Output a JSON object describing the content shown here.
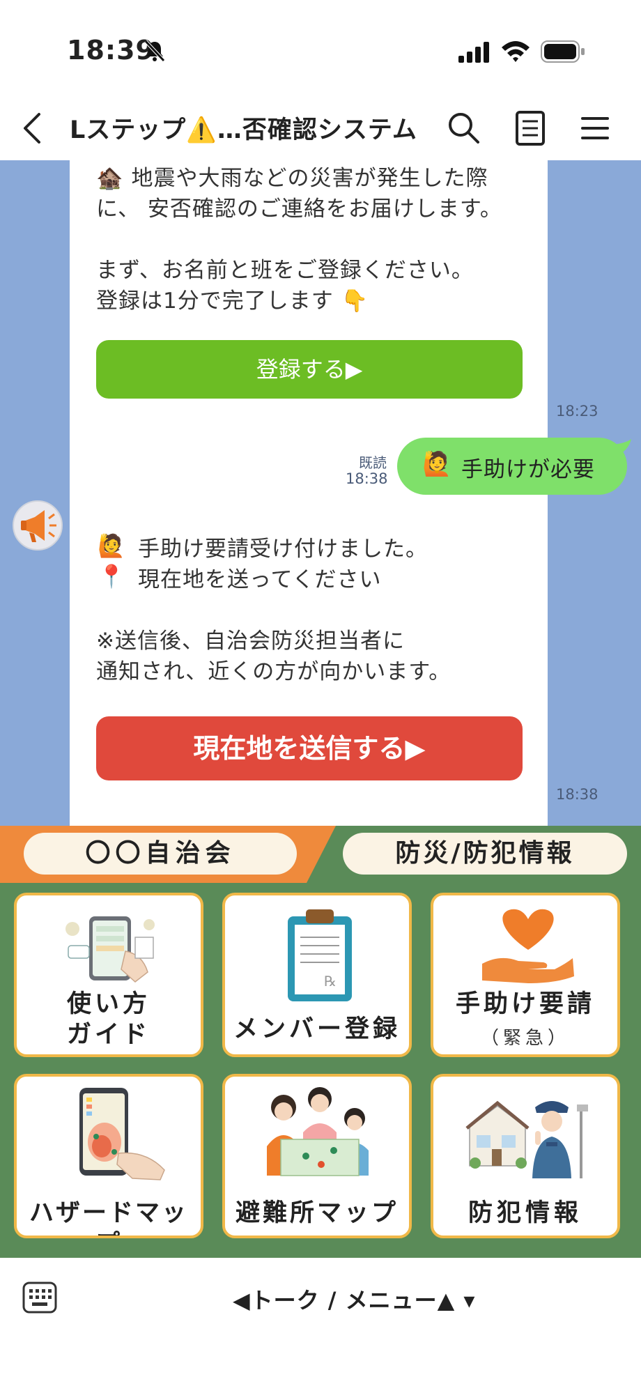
{
  "status_bar": {
    "time": "18:39"
  },
  "header": {
    "title": "Lステップ⚠️…否確認システム"
  },
  "messages": {
    "first": {
      "line1": "🏚️ 地震や大雨などの災害が発生した際",
      "line2": "に、 安否確認のご連絡をお届けします。",
      "line3": "まず、お名前と班をご登録ください。",
      "line4": "登録は1分で完了します 👇",
      "button": "登録する▶",
      "time": "18:23"
    },
    "sent": {
      "text": "手助けが必要",
      "emoji": "🙋",
      "read_label": "既読",
      "time": "18:38"
    },
    "second": {
      "line1": "手助け要請受け付けました。",
      "line2": "現在地を送ってください",
      "emoji1": "🙋",
      "emoji2": "📍",
      "line3": "※送信後、自治会防災担当者に",
      "line4": "通知され、近くの方が向かいます。",
      "button": "現在地を送信する▶",
      "time": "18:38"
    }
  },
  "rich_menu": {
    "tabs": [
      "〇〇自治会",
      "防災/防犯情報"
    ],
    "tiles": [
      {
        "label_line1": "使い方",
        "label_line2": "ガイド",
        "icon": "guide-icon"
      },
      {
        "label": "メンバー登録",
        "icon": "clipboard-icon"
      },
      {
        "label": "手助け要請",
        "sub": "（緊急）",
        "icon": "heart-hand-icon"
      },
      {
        "label": "ハザードマップ",
        "icon": "hazard-map-icon"
      },
      {
        "label": "避難所マップ",
        "icon": "shelter-map-icon"
      },
      {
        "label": "防犯情報",
        "icon": "crime-prevention-icon"
      }
    ]
  },
  "footer": {
    "label": "◀トーク / メニュー▲ ▾"
  },
  "colors": {
    "chat_bg": "#8aa9d8",
    "register_button": "#6cbd24",
    "location_button": "#e0493c",
    "sent_bubble": "#7fe06a",
    "menu_bg": "#5a8b58",
    "menu_accent": "#ef8a3c"
  }
}
